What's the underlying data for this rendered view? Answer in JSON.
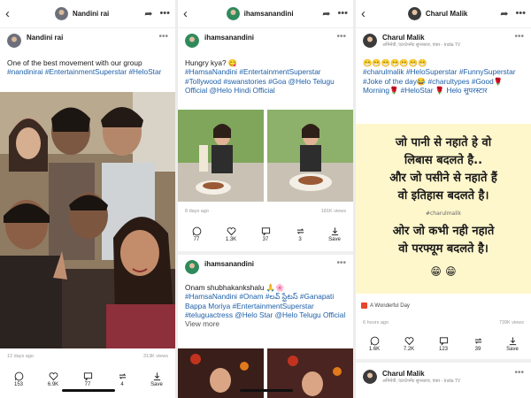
{
  "columns": [
    {
      "top_title": "Nandini rai",
      "post": {
        "author": "Nandini rai",
        "caption_text": "One of the best movement with our group ",
        "caption_tags": "#nandinirai #EntertainmentSuperstar #HeloStar",
        "time": "12 days ago",
        "views": "313K views",
        "actions": {
          "whatsapp": "153",
          "like": "6.9K",
          "comment": "77",
          "share": "4",
          "save": "Save"
        }
      }
    },
    {
      "top_title": "ihamsanandini",
      "post": {
        "author": "ihamsanandini",
        "caption_text": "Hungry kya? 😋",
        "caption_tags": "#HamsaNandini #EntertainmentSuperstar #Tollywood #swanstories #Goa @Helo Telugu Official @Helo Hindi Official",
        "time": "8 days ago",
        "views": "181K views",
        "actions": {
          "whatsapp": "77",
          "like": "1.3K",
          "comment": "37",
          "share": "3",
          "save": "Save"
        }
      },
      "post2": {
        "author": "ihamsanandini",
        "caption_text": "Onam shubhakankshalu 🙏🌸",
        "caption_tags": "#HamsaNandini #Onam #లవ్ స్టేటస్ #Ganapati Bappa Moriya #EntertainmentSuperstar #teluguactress @Helo Star @Helo Telugu Official",
        "view_more": "View more"
      }
    },
    {
      "top_title": "Charul Malik",
      "post": {
        "author": "Charul Malik",
        "author_sub": "अभिनेत्री, एंटरटेनमेंट सुपरस्टार, एंकर - India TV",
        "emojis": "😁😁😁😁😁😁😁",
        "caption_tags": "#charulmalik #HeloSuperstar #FunnySuperstar #Joke of the day😂 #charultypes #Good🌹Morning🌹 #HeloStar 🌹 Helo सुपरस्टार",
        "quote_line1": "जो पानी से नहाते हे वो",
        "quote_line2": "लिबास बदलते है..",
        "quote_line3": "और जो पसीने से नहाते हैं",
        "quote_line4": "वो इतिहास बदलते है।",
        "quote_tag": "#charulmalik",
        "quote_line5": "ओर जो कभी नही नहाते",
        "quote_line6": "वो परफ्यूम बदलते है।",
        "quote_emoji": "😁 😁",
        "chip": "A Wonderful Day",
        "time": "6 hours ago",
        "views": "739K views",
        "actions": {
          "whatsapp": "1.6K",
          "like": "7.2K",
          "comment": "123",
          "share": "39",
          "save": "Save"
        }
      },
      "post2": {
        "author": "Charul Malik",
        "author_sub": "अभिनेत्री, एंटरटेनमेंट सुपरस्टार, एंकर - India TV"
      }
    }
  ],
  "icons": [
    "back-arrow-icon",
    "share-arrow-icon",
    "more-icon",
    "whatsapp-icon",
    "heart-icon",
    "comment-icon",
    "repost-icon",
    "download-icon"
  ],
  "colors": {
    "hashtag": "#1d5fa8",
    "quote_bg": "#fff7cc",
    "accent": "#e8442e"
  }
}
